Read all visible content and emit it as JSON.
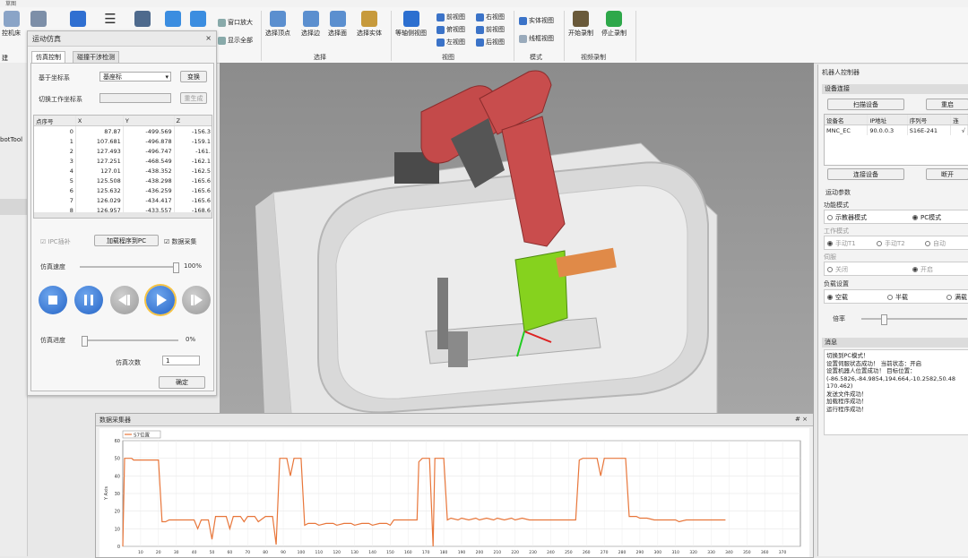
{
  "window": {
    "title": "草图"
  },
  "ribbon": {
    "left_cut_labels": [
      "控机床",
      "建"
    ],
    "view_btns": [
      {
        "label": "窗口放大"
      },
      {
        "label": "显示全部"
      }
    ],
    "select_group": {
      "label": "选择",
      "buttons": [
        {
          "label": "选择顶点"
        },
        {
          "label": "选择边"
        },
        {
          "label": "选择面"
        },
        {
          "label": "选择实体"
        }
      ]
    },
    "view_group": {
      "label": "视图",
      "iso_label": "等轴侧视图",
      "small": [
        "前视图",
        "右视图",
        "俯视图",
        "前视图",
        "左视图",
        "后视图"
      ]
    },
    "mode_group": {
      "label": "模式",
      "items": [
        "实体视图",
        "线框视图"
      ]
    },
    "record_group": {
      "label": "视频录制",
      "start": "开始录制",
      "stop": "停止录制"
    }
  },
  "leftstrip": {
    "label": "botTool"
  },
  "sim": {
    "title": "运动仿真",
    "close": "×",
    "tabs": [
      "仿真控制",
      "碰撞干涉检测"
    ],
    "base_label": "基于坐标系",
    "base_value": "基座标",
    "switch_btn": "变换",
    "work_label": "切换工作坐标系",
    "regen_btn": "重生成",
    "table": {
      "headers": [
        "点序号",
        "X",
        "Y",
        "Z"
      ],
      "rows": [
        [
          "0",
          "87.87",
          "-499.569",
          "-156.3"
        ],
        [
          "1",
          "107.681",
          "-496.878",
          "-159.1"
        ],
        [
          "2",
          "127.493",
          "-496.747",
          "-161."
        ],
        [
          "3",
          "127.251",
          "-468.549",
          "-162.1"
        ],
        [
          "4",
          "127.01",
          "-438.352",
          "-162.5"
        ],
        [
          "5",
          "125.508",
          "-438.298",
          "-165.6"
        ],
        [
          "6",
          "125.632",
          "-436.259",
          "-165.6"
        ],
        [
          "7",
          "126.029",
          "-434.417",
          "-165.6"
        ],
        [
          "8",
          "126.957",
          "-433.557",
          "-168.6"
        ]
      ]
    },
    "ipc_label": "IPC插补",
    "load_btn": "加载程序到PC",
    "collect_label": "数据采集",
    "speed_label": "仿真速度",
    "speed_value": "100%",
    "speed_fraction": 1.0,
    "progress_label": "仿真进度",
    "progress_value": "0%",
    "progress_fraction": 0.0,
    "count_label": "仿真次数",
    "count_value": "1",
    "ok_btn": "确定"
  },
  "right": {
    "title": "机器人控制器",
    "conn_section": "设备连接",
    "scan_btn": "扫描设备",
    "reset_btn": "重启",
    "dev_headers": [
      "设备名",
      "IP地址",
      "序列号",
      "连"
    ],
    "dev_row": [
      "MNC_EC",
      "90.0.0.3",
      "S16E-241",
      "√"
    ],
    "connect_btn": "连接设备",
    "disconnect_btn": "断开",
    "motion_section": "运动参数",
    "func_label": "功能模式",
    "func_opts": [
      "示教器模式",
      "PC模式"
    ],
    "work_label": "工作模式",
    "work_opts": [
      "手动T1",
      "手动T2",
      "自动"
    ],
    "servo_label": "伺服",
    "servo_opts": [
      "关闭",
      "开启"
    ],
    "load_label": "负载设置",
    "load_opts": [
      "空载",
      "半载",
      "满载"
    ],
    "ratio_label": "倍率",
    "msg_section": "消息",
    "messages": [
      "切换到PC模式！",
      "设置伺服状态成功！ 当前状态：开启",
      "设置机器人位置成功！ 目标位置：",
      "(-86.5826,-84.9854,194.664,-10.2582,50.48",
      "170.462)",
      "发送文件成功！",
      "加载程序成功！",
      "运行程序成功！"
    ]
  },
  "collector": {
    "title": "数据采集器",
    "pin": "# ×",
    "legend": "S7位置",
    "ylabel": "Y Axis"
  },
  "chart_data": {
    "type": "line",
    "series": [
      {
        "name": "S7位置",
        "color": "#e8763a",
        "points": [
          [
            0,
            0
          ],
          [
            1,
            50
          ],
          [
            4,
            50
          ],
          [
            5,
            50
          ],
          [
            6,
            49
          ],
          [
            10,
            49
          ],
          [
            18,
            49
          ],
          [
            20,
            49
          ],
          [
            22,
            14
          ],
          [
            24,
            14
          ],
          [
            26,
            15
          ],
          [
            30,
            15
          ],
          [
            40,
            15
          ],
          [
            42,
            10
          ],
          [
            44,
            15
          ],
          [
            48,
            15
          ],
          [
            50,
            4
          ],
          [
            52,
            17
          ],
          [
            55,
            17
          ],
          [
            58,
            17
          ],
          [
            60,
            10
          ],
          [
            62,
            17
          ],
          [
            66,
            17
          ],
          [
            68,
            14
          ],
          [
            70,
            17
          ],
          [
            74,
            17
          ],
          [
            76,
            14
          ],
          [
            80,
            17
          ],
          [
            84,
            17
          ],
          [
            86,
            1
          ],
          [
            88,
            50
          ],
          [
            90,
            50
          ],
          [
            92,
            50
          ],
          [
            94,
            40
          ],
          [
            96,
            50
          ],
          [
            100,
            50
          ],
          [
            102,
            12
          ],
          [
            104,
            13
          ],
          [
            108,
            13
          ],
          [
            110,
            12
          ],
          [
            114,
            13
          ],
          [
            118,
            13
          ],
          [
            120,
            12
          ],
          [
            124,
            13
          ],
          [
            128,
            13
          ],
          [
            130,
            12
          ],
          [
            134,
            13
          ],
          [
            138,
            13
          ],
          [
            140,
            12
          ],
          [
            144,
            13
          ],
          [
            148,
            13
          ],
          [
            150,
            12
          ],
          [
            152,
            15
          ],
          [
            158,
            15
          ],
          [
            160,
            15
          ],
          [
            163,
            15
          ],
          [
            165,
            15
          ],
          [
            166,
            48
          ],
          [
            168,
            50
          ],
          [
            172,
            50
          ],
          [
            174,
            0
          ],
          [
            175,
            50
          ],
          [
            178,
            50
          ],
          [
            180,
            50
          ],
          [
            182,
            15
          ],
          [
            184,
            16
          ],
          [
            188,
            15
          ],
          [
            190,
            16
          ],
          [
            194,
            15
          ],
          [
            198,
            16
          ],
          [
            200,
            15
          ],
          [
            204,
            16
          ],
          [
            208,
            15
          ],
          [
            210,
            16
          ],
          [
            214,
            15
          ],
          [
            218,
            16
          ],
          [
            220,
            15
          ],
          [
            224,
            16
          ],
          [
            228,
            15
          ],
          [
            230,
            15
          ],
          [
            234,
            15
          ],
          [
            238,
            15
          ],
          [
            242,
            15
          ],
          [
            246,
            15
          ],
          [
            250,
            15
          ],
          [
            252,
            15
          ],
          [
            254,
            15
          ],
          [
            256,
            49
          ],
          [
            258,
            50
          ],
          [
            262,
            50
          ],
          [
            266,
            50
          ],
          [
            268,
            40
          ],
          [
            270,
            50
          ],
          [
            274,
            50
          ],
          [
            278,
            50
          ],
          [
            282,
            50
          ],
          [
            284,
            17
          ],
          [
            288,
            17
          ],
          [
            290,
            16
          ],
          [
            294,
            16
          ],
          [
            298,
            15
          ],
          [
            302,
            15
          ],
          [
            306,
            15
          ],
          [
            310,
            15
          ],
          [
            312,
            14
          ],
          [
            316,
            15
          ],
          [
            320,
            15
          ],
          [
            324,
            15
          ],
          [
            326,
            15
          ],
          [
            330,
            15
          ],
          [
            334,
            15
          ],
          [
            338,
            15
          ]
        ]
      }
    ],
    "xlim": [
      0,
      380
    ],
    "ylim": [
      0,
      60
    ],
    "yticks": [
      0,
      10,
      20,
      30,
      40,
      50,
      60
    ],
    "xticks": [
      10,
      20,
      30,
      40,
      50,
      60,
      70,
      80,
      90,
      100,
      110,
      120,
      130,
      140,
      150,
      160,
      170,
      180,
      190,
      200,
      210,
      220,
      230,
      240,
      250,
      260,
      270,
      280,
      290,
      300,
      310,
      320,
      330,
      340,
      350,
      360,
      370
    ],
    "grid": true,
    "legend_position": "top-left"
  }
}
